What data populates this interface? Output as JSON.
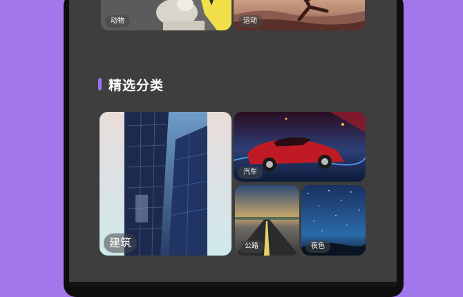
{
  "top_row": {
    "animal_label": "动物",
    "sport_label": "运动"
  },
  "section": {
    "title": "精选分类"
  },
  "categories": {
    "architecture": "建筑",
    "car": "汽车",
    "road": "公路",
    "night": "夜色"
  },
  "colors": {
    "background": "#a277ec",
    "screen": "#3e3e3e",
    "accent_bar": "#a26cf3"
  }
}
